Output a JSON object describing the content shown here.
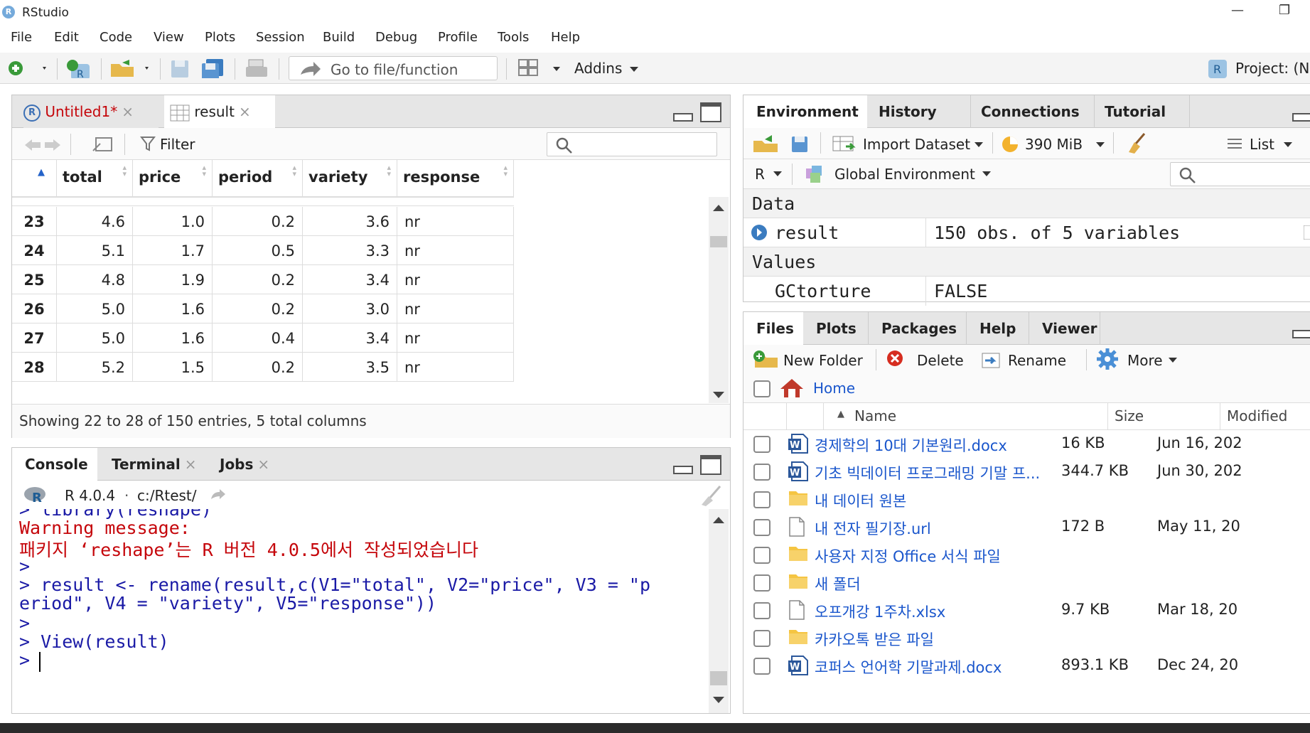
{
  "window": {
    "title": "RStudio",
    "minimize": "—",
    "maximize": "❐"
  },
  "menu": [
    "File",
    "Edit",
    "Code",
    "View",
    "Plots",
    "Session",
    "Build",
    "Debug",
    "Profile",
    "Tools",
    "Help"
  ],
  "toolbar": {
    "goto_placeholder": "Go to file/function",
    "addins": "Addins",
    "project": "Project: (No"
  },
  "source": {
    "tabs": [
      {
        "label": "Untitled1*"
      },
      {
        "label": "result"
      }
    ],
    "filter": "Filter",
    "columns": [
      "total",
      "price",
      "period",
      "variety",
      "response"
    ],
    "rows": [
      {
        "idx": "23",
        "total": "4.6",
        "price": "1.0",
        "period": "0.2",
        "variety": "3.6",
        "response": "nr"
      },
      {
        "idx": "24",
        "total": "5.1",
        "price": "1.7",
        "period": "0.5",
        "variety": "3.3",
        "response": "nr"
      },
      {
        "idx": "25",
        "total": "4.8",
        "price": "1.9",
        "period": "0.2",
        "variety": "3.4",
        "response": "nr"
      },
      {
        "idx": "26",
        "total": "5.0",
        "price": "1.6",
        "period": "0.2",
        "variety": "3.0",
        "response": "nr"
      },
      {
        "idx": "27",
        "total": "5.0",
        "price": "1.6",
        "period": "0.4",
        "variety": "3.4",
        "response": "nr"
      },
      {
        "idx": "28",
        "total": "5.2",
        "price": "1.5",
        "period": "0.2",
        "variety": "3.5",
        "response": "nr"
      }
    ],
    "status": "Showing 22 to 28 of 150 entries, 5 total columns"
  },
  "console": {
    "tabs": [
      "Console",
      "Terminal",
      "Jobs"
    ],
    "version": "R 4.0.4",
    "path": "c:/Rtest/",
    "lines": [
      {
        "text": "> library(reshape)",
        "color": "#1a1aa6"
      },
      {
        "text": "Warning message:",
        "color": "#c5060b"
      },
      {
        "text": "패키지 ‘reshape’는 R 버전 4.0.5에서 작성되었습니다",
        "color": "#c5060b"
      },
      {
        "text": ">",
        "color": "#1a1aa6"
      },
      {
        "text": "> result <- rename(result,c(V1=\"total\", V2=\"price\", V3 = \"p",
        "color": "#1a1aa6"
      },
      {
        "text": "eriod\", V4 = \"variety\", V5=\"response\"))",
        "color": "#1a1aa6"
      },
      {
        "text": ">",
        "color": "#1a1aa6"
      },
      {
        "text": "> View(result)",
        "color": "#1a1aa6"
      },
      {
        "text": "> ",
        "color": "#1a1aa6"
      }
    ]
  },
  "environment": {
    "tabs": [
      "Environment",
      "History",
      "Connections",
      "Tutorial"
    ],
    "import_dataset": "Import Dataset",
    "memory": "390 MiB",
    "view_mode": "List",
    "language": "R",
    "scope": "Global Environment",
    "section_data": "Data",
    "data_rows": [
      {
        "name": "result",
        "value": "150 obs. of 5 variables"
      }
    ],
    "section_values": "Values",
    "value_rows": [
      {
        "name": "GCtorture",
        "value": "FALSE"
      }
    ]
  },
  "files": {
    "tabs": [
      "Files",
      "Plots",
      "Packages",
      "Help",
      "Viewer"
    ],
    "actions": {
      "new_folder": "New Folder",
      "delete": "Delete",
      "rename": "Rename",
      "more": "More"
    },
    "breadcrumb": "Home",
    "columns": {
      "name": "Name",
      "size": "Size",
      "modified": "Modified"
    },
    "rows": [
      {
        "name": "경제학의 10대 기본원리.docx",
        "size": "16 KB",
        "modified": "Jun 16, 202",
        "type": "word"
      },
      {
        "name": "기초 빅데이터 프로그래밍 기말 프...",
        "size": "344.7 KB",
        "modified": "Jun 30, 202",
        "type": "word"
      },
      {
        "name": "내 데이터 원본",
        "size": "",
        "modified": "",
        "type": "folder"
      },
      {
        "name": "내 전자 필기장.url",
        "size": "172 B",
        "modified": "May 11, 20",
        "type": "file"
      },
      {
        "name": "사용자 지정 Office 서식 파일",
        "size": "",
        "modified": "",
        "type": "folder"
      },
      {
        "name": "새 폴더",
        "size": "",
        "modified": "",
        "type": "folder"
      },
      {
        "name": "오프개강 1주차.xlsx",
        "size": "9.7 KB",
        "modified": "Mar 18, 20",
        "type": "file"
      },
      {
        "name": "카카오톡 받은 파일",
        "size": "",
        "modified": "",
        "type": "folder"
      },
      {
        "name": "코퍼스 언어학 기말과제.docx",
        "size": "893.1 KB",
        "modified": "Dec 24, 20",
        "type": "word"
      }
    ]
  }
}
